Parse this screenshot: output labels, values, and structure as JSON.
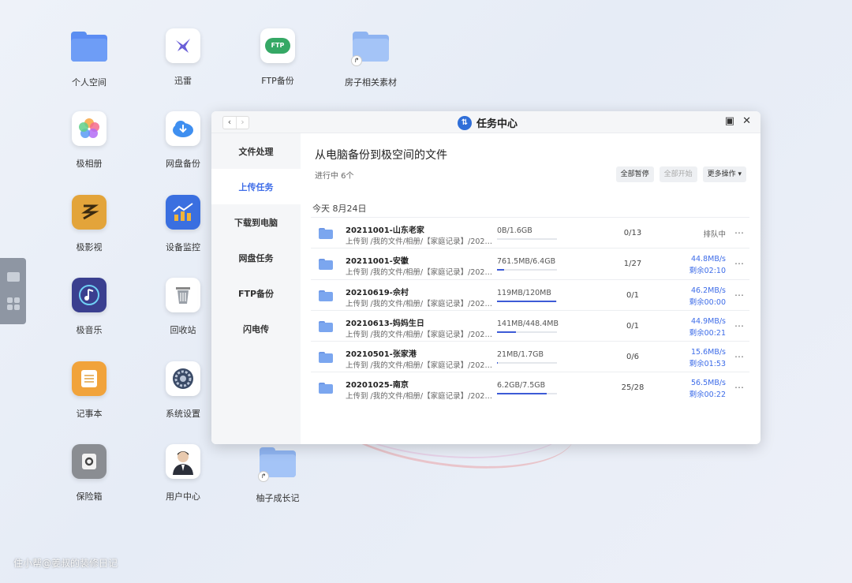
{
  "desktop": {
    "icons": [
      {
        "label": "个人空间",
        "icon": "folder-icon"
      },
      {
        "label": "迅雷",
        "icon": "thunder-bird-icon"
      },
      {
        "label": "FTP备份",
        "icon": "ftp-cloud-icon"
      },
      {
        "label": "房子相关素材",
        "icon": "shared-folder-icon"
      },
      {
        "label": "极相册",
        "icon": "photos-flower-icon"
      },
      {
        "label": "网盘备份",
        "icon": "cloud-download-icon"
      },
      {
        "label": "极影视",
        "icon": "video-app-icon"
      },
      {
        "label": "设备监控",
        "icon": "monitor-chart-icon"
      },
      {
        "label": "极音乐",
        "icon": "music-note-icon"
      },
      {
        "label": "回收站",
        "icon": "trash-icon"
      },
      {
        "label": "记事本",
        "icon": "notepad-icon"
      },
      {
        "label": "系统设置",
        "icon": "settings-gear-icon"
      },
      {
        "label": "保险箱",
        "icon": "safe-icon"
      },
      {
        "label": "用户中心",
        "icon": "user-avatar-icon"
      },
      {
        "label": "柚子成长记",
        "icon": "shared-folder-icon"
      }
    ],
    "ftp_badge": "FTP",
    "watermark": "住小帮@姜叔的装修日记"
  },
  "window": {
    "title": "任务中心",
    "sidebar": [
      "文件处理",
      "上传任务",
      "下载到电脑",
      "网盘任务",
      "FTP备份",
      "闪电传"
    ],
    "active_sidebar": "上传任务",
    "heading": "从电脑备份到极空间的文件",
    "subheading": "进行中 6个",
    "actions": {
      "pause_all": "全部暂停",
      "start_all": "全部开始",
      "more": "更多操作 ▾"
    },
    "date_group": "今天 8月24日",
    "tasks": [
      {
        "name": "20211001-山东老家",
        "path": "上传到 /我的文件/相册/【家庭记录】/2021…",
        "size": "0B/1.6GB",
        "progress": 0,
        "count": "0/13",
        "speed": "排队中",
        "remaining": ""
      },
      {
        "name": "20211001-安徽",
        "path": "上传到 /我的文件/相册/【家庭记录】/2021…",
        "size": "761.5MB/6.4GB",
        "progress": 0.12,
        "count": "1/27",
        "speed": "44.8MB/s",
        "remaining": "剩余02:10"
      },
      {
        "name": "20210619-佘村",
        "path": "上传到 /我的文件/相册/【家庭记录】/2021…",
        "size": "119MB/120MB",
        "progress": 0.99,
        "count": "0/1",
        "speed": "46.2MB/s",
        "remaining": "剩余00:00"
      },
      {
        "name": "20210613-妈妈生日",
        "path": "上传到 /我的文件/相册/【家庭记录】/2021…",
        "size": "141MB/448.4MB",
        "progress": 0.31,
        "count": "0/1",
        "speed": "44.9MB/s",
        "remaining": "剩余00:21"
      },
      {
        "name": "20210501-张家港",
        "path": "上传到 /我的文件/相册/【家庭记录】/2021…",
        "size": "21MB/1.7GB",
        "progress": 0.01,
        "count": "0/6",
        "speed": "15.6MB/s",
        "remaining": "剩余01:53"
      },
      {
        "name": "20201025-南京",
        "path": "上传到 /我的文件/相册/【家庭记录】/2020…",
        "size": "6.2GB/7.5GB",
        "progress": 0.83,
        "count": "25/28",
        "speed": "56.5MB/s",
        "remaining": "剩余00:22"
      }
    ]
  },
  "colors": {
    "accent": "#3d6ce8",
    "progress": "#3d5bd6"
  }
}
